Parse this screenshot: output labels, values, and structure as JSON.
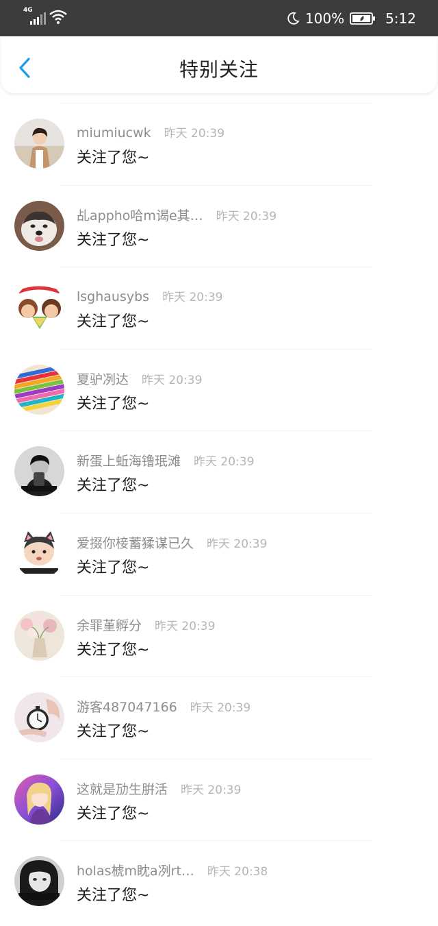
{
  "status_bar": {
    "network": "4G",
    "battery": "100%",
    "time": "5:12",
    "icons": [
      "signal-icon",
      "wifi-icon",
      "moon-icon",
      "battery-icon"
    ]
  },
  "header": {
    "back_icon": "chevron-left-icon",
    "title": "特别关注",
    "accent_color": "#1a9cf0"
  },
  "notifications": [
    {
      "username": "miumiucwk",
      "time": "昨天 20:39",
      "message": "关注了您~",
      "avatar": "avatar-boy-photo"
    },
    {
      "username": "乩appho哈m谒e其…",
      "time": "昨天 20:39",
      "message": "关注了您~",
      "avatar": "avatar-husky-dog"
    },
    {
      "username": "lsghausybs",
      "time": "昨天 20:39",
      "message": "关注了您~",
      "avatar": "avatar-cartoon-couple"
    },
    {
      "username": "夏驴冽达",
      "time": "昨天 20:39",
      "message": "关注了您~",
      "avatar": "avatar-color-pencils"
    },
    {
      "username": "新蛋上蚯海镥珉滩",
      "time": "昨天 20:39",
      "message": "关注了您~",
      "avatar": "avatar-bw-portrait"
    },
    {
      "username": "爱掇你椄蓄猱谋已久",
      "time": "昨天 20:39",
      "message": "关注了您~",
      "avatar": "avatar-cat-ear-cartoon"
    },
    {
      "username": "余罪堇孵分",
      "time": "昨天 20:39",
      "message": "关注了您~",
      "avatar": "avatar-flower-vase"
    },
    {
      "username": "游客487047166",
      "time": "昨天 20:39",
      "message": "关注了您~",
      "avatar": "avatar-pocket-watch"
    },
    {
      "username": "这就是劢生腁活",
      "time": "昨天 20:39",
      "message": "关注了您~",
      "avatar": "avatar-anime-girl"
    },
    {
      "username": "holas椃m眈a冽rt…",
      "time": "昨天 20:38",
      "message": "关注了您~",
      "avatar": "avatar-bw-girl"
    }
  ]
}
